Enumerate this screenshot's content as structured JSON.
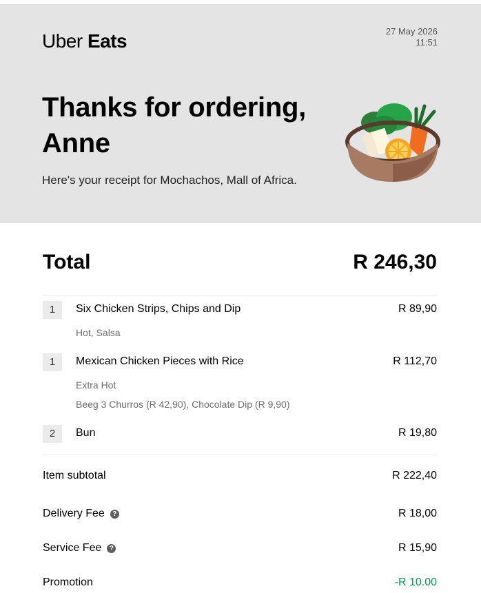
{
  "brand": {
    "name_light": "Uber",
    "name_bold": "Eats"
  },
  "header": {
    "date": "27 May 2026",
    "time": "11:51"
  },
  "hero": {
    "thanks": "Thanks for ordering, Anne",
    "subtitle": "Here's your receipt for Mochachos, Mall of Africa.",
    "illustration": "food-bowl-icon"
  },
  "total": {
    "label": "Total",
    "value": "R 246,30"
  },
  "items": [
    {
      "qty": "1",
      "name": "Six Chicken Strips, Chips and Dip",
      "price": "R 89,90",
      "options": [
        "Hot, Salsa"
      ]
    },
    {
      "qty": "1",
      "name": "Mexican Chicken Pieces with Rice",
      "price": "R 112,70",
      "options": [
        "Extra Hot",
        "Beeg 3 Churros (R 42,90), Chocolate Dip (R 9,90)"
      ]
    },
    {
      "qty": "2",
      "name": "Bun",
      "price": "R 19,80",
      "options": []
    }
  ],
  "summary": {
    "subtotal": {
      "label": "Item subtotal",
      "value": "R 222,40"
    },
    "delivery": {
      "label": "Delivery Fee",
      "value": "R 18,00",
      "help_icon": "question-circle-icon"
    },
    "service": {
      "label": "Service Fee",
      "value": "R 15,90",
      "help_icon": "question-circle-icon"
    },
    "promotion": {
      "label": "Promotion",
      "value": "-R 10.00"
    }
  },
  "colors": {
    "hero_bg": "#e4e4e4",
    "promo_green": "#05944f"
  }
}
